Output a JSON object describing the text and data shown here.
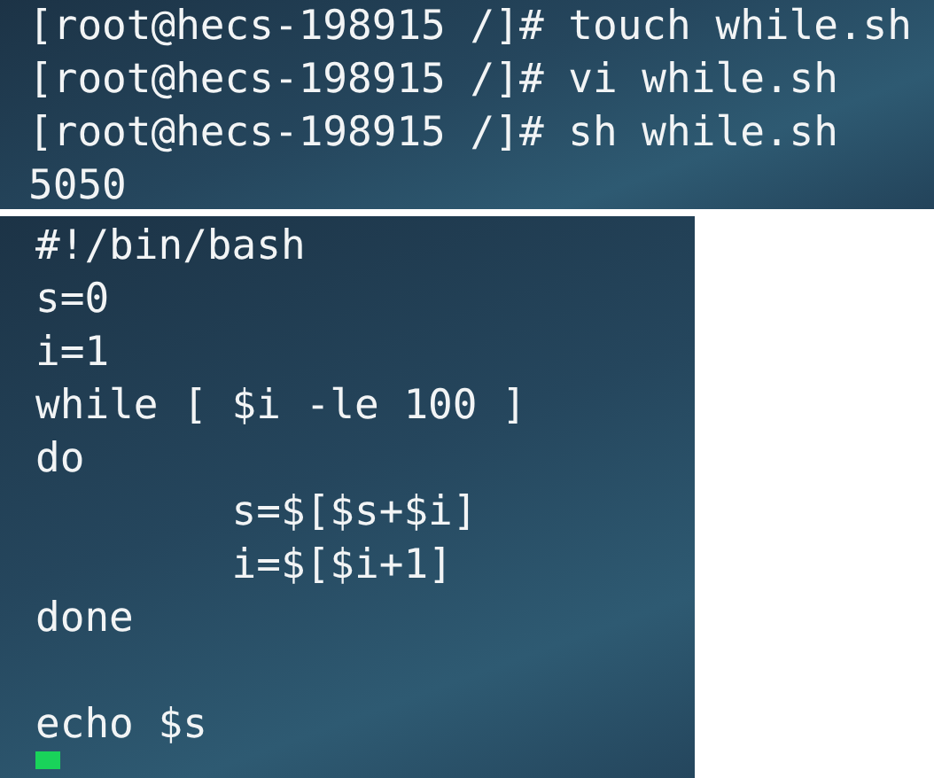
{
  "top_terminal": {
    "lines": [
      {
        "kind": "line",
        "text": "[root@hecs-198915 /]# touch while.sh"
      },
      {
        "kind": "line",
        "text": "[root@hecs-198915 /]# vi while.sh"
      },
      {
        "kind": "line",
        "text": "[root@hecs-198915 /]# sh while.sh"
      },
      {
        "kind": "line",
        "text": "5050"
      }
    ]
  },
  "bottom_terminal": {
    "lines": [
      {
        "kind": "line",
        "text": "#!/bin/bash"
      },
      {
        "kind": "line",
        "text": "s=0"
      },
      {
        "kind": "line",
        "text": "i=1"
      },
      {
        "kind": "line",
        "text": "while [ $i -le 100 ]"
      },
      {
        "kind": "line",
        "text": "do"
      },
      {
        "kind": "line",
        "text": "\ts=$[$s+$i]"
      },
      {
        "kind": "line",
        "text": "\ti=$[$i+1]"
      },
      {
        "kind": "line",
        "text": "done"
      },
      {
        "kind": "blank"
      },
      {
        "kind": "line",
        "text": "echo $s"
      },
      {
        "kind": "cursor"
      }
    ]
  }
}
